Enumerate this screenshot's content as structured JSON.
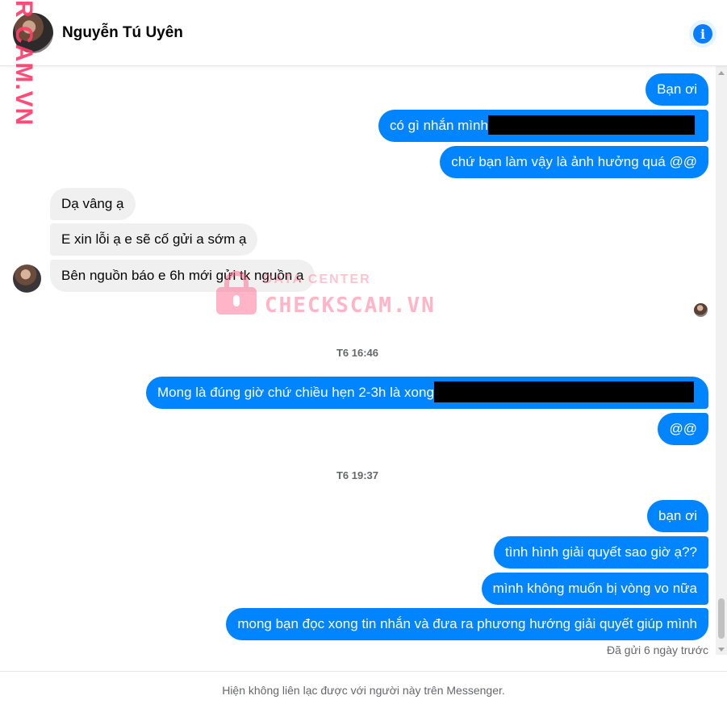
{
  "header": {
    "contact_name": "Nguyễn Tú Uyên",
    "info_glyph": "i",
    "accent_color": "#0a7cff"
  },
  "watermark": {
    "side_text": "R CAM.VN",
    "small_text": "DATA CENTER",
    "big_text": "CHECKSCAM.VN"
  },
  "messages": {
    "m1": "Bạn ơi",
    "m2": "có gì nhắn mình",
    "m3": "chứ bạn làm vậy là ảnh hưởng quá @@",
    "m4": "Dạ vâng ạ",
    "m5": "E xin lỗi ạ e sẽ cố gửi a sớm ạ",
    "m6": "Bên nguồn báo e 6h mới gửi tk nguồn ạ",
    "ts1": "T6 16:46",
    "m7": "Mong là đúng giờ chứ chiều hẹn 2-3h là xong",
    "m8": "@@",
    "ts2": "T6 19:37",
    "m9": "bạn ơi",
    "m10": "tình hình giải quyết sao giờ ạ??",
    "m11": "mình không muốn bị vòng vo nữa",
    "m12": "mong bạn đọc xong tin nhắn và đưa ra phương hướng giải quyết giúp mình"
  },
  "status": {
    "sent": "Đã gửi 6 ngày trước"
  },
  "footer": {
    "notice": "Hiện không liên lạc được với người này trên Messenger."
  },
  "colors": {
    "outgoing_bubble": "#0084ff",
    "incoming_bubble": "#f0f0f0"
  }
}
